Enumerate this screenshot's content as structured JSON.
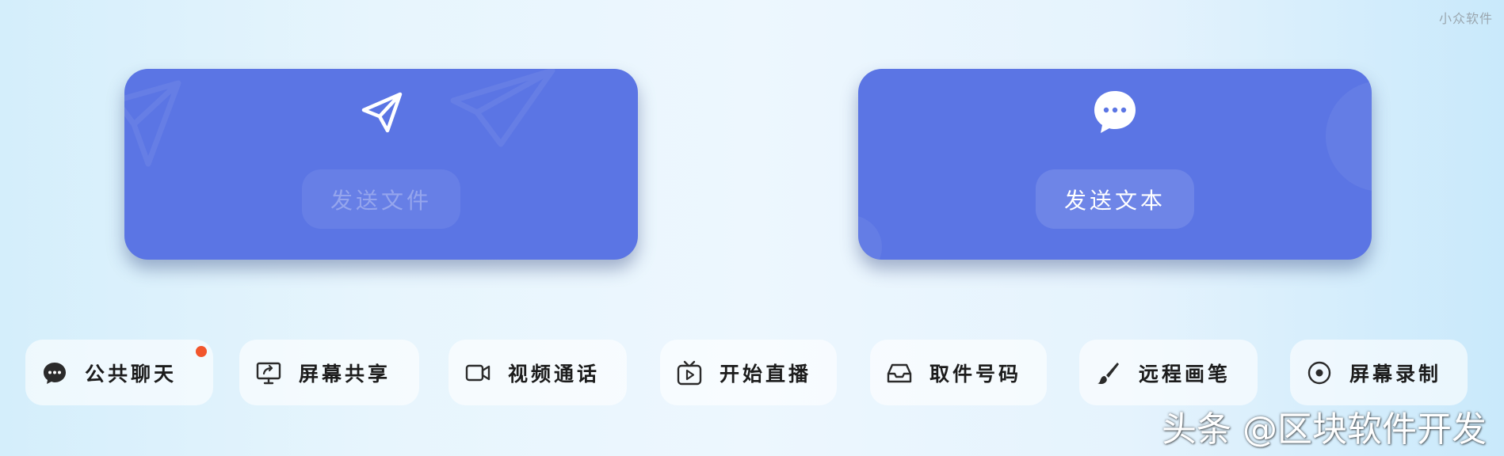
{
  "watermark_top": "小众软件",
  "cards": {
    "send_file": {
      "label": "发送文件",
      "icon": "paper-plane-icon",
      "disabled": true
    },
    "send_text": {
      "label": "发送文本",
      "icon": "chat-bubble-icon",
      "disabled": false
    }
  },
  "colors": {
    "card_bg": "#5b75e4",
    "badge": "#f2562c",
    "text_dark": "#1c1c1c"
  },
  "tools": [
    {
      "label": "公共聊天",
      "icon": "chat-bubble-icon",
      "badge": true
    },
    {
      "label": "屏幕共享",
      "icon": "screen-share-icon",
      "badge": false
    },
    {
      "label": "视频通话",
      "icon": "video-camera-icon",
      "badge": false
    },
    {
      "label": "开始直播",
      "icon": "tv-play-icon",
      "badge": false
    },
    {
      "label": "取件号码",
      "icon": "inbox-tray-icon",
      "badge": false
    },
    {
      "label": "远程画笔",
      "icon": "brush-icon",
      "badge": false
    },
    {
      "label": "屏幕录制",
      "icon": "record-icon",
      "badge": false
    }
  ],
  "watermark_bottom": "头条 @区块软件开发"
}
